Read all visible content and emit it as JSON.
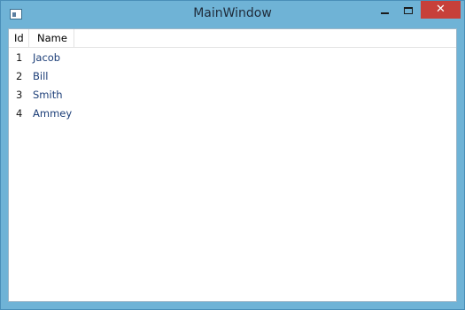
{
  "window": {
    "title": "MainWindow",
    "close_glyph": "✕"
  },
  "grid": {
    "columns": [
      "Id",
      "Name"
    ],
    "rows": [
      {
        "id": "1",
        "name": "Jacob"
      },
      {
        "id": "2",
        "name": "Bill"
      },
      {
        "id": "3",
        "name": "Smith"
      },
      {
        "id": "4",
        "name": "Ammey"
      }
    ]
  },
  "colors": {
    "frame": "#6fb3d6",
    "close_button": "#c7403a",
    "name_text": "#1c3e78"
  }
}
